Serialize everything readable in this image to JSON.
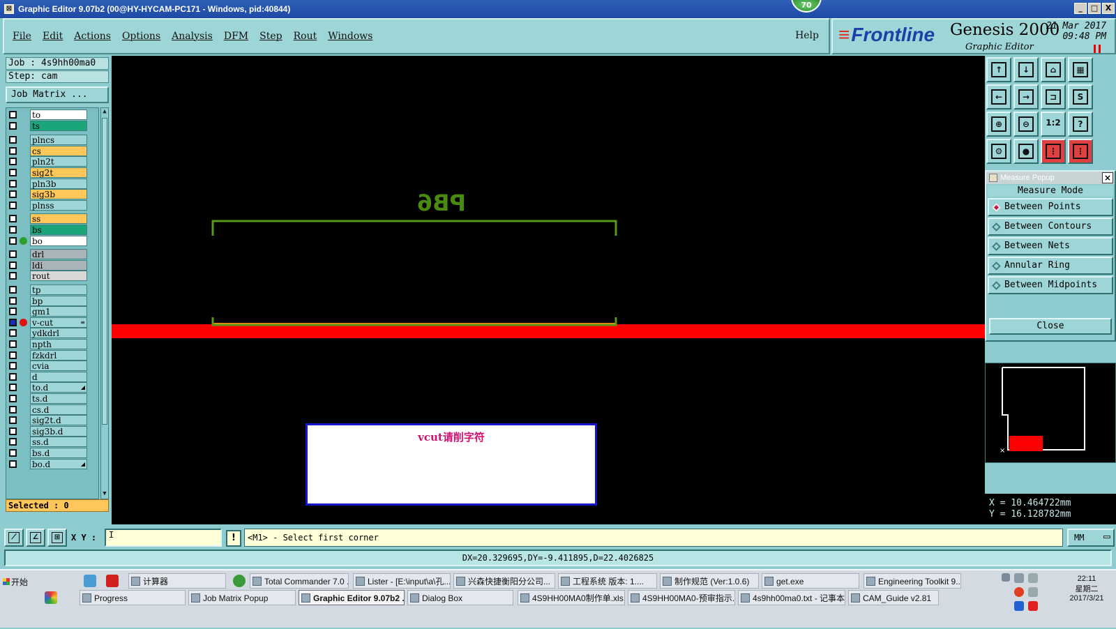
{
  "window": {
    "title": "Graphic Editor 9.07b2 (00@HY-HYCAM-PC171 - Windows, pid:40844)",
    "badge": "70",
    "min": "_",
    "max": "□",
    "close": "X"
  },
  "menu": {
    "items": [
      "File",
      "Edit",
      "Actions",
      "Options",
      "Analysis",
      "DFM",
      "Step",
      "Rout",
      "Windows"
    ],
    "help": "Help"
  },
  "brand": {
    "logo": "Frontline",
    "product": "Genesis 2000",
    "subtitle": "Graphic Editor",
    "date": "21 Mar 2017",
    "time": "09:48 PM"
  },
  "left": {
    "job": "Job : 4s9hh00ma0",
    "step": "Step: cam",
    "job_matrix": "Job Matrix ...",
    "selected": "Selected : 0",
    "layers": [
      {
        "name": "to",
        "color": "#ffffff",
        "group": 0
      },
      {
        "name": "ts",
        "color": "#1aa67a",
        "group": 0
      },
      {
        "name": "plncs",
        "color": "#9ed6d8",
        "group": 1
      },
      {
        "name": "cs",
        "color": "#ffc65a",
        "group": 1
      },
      {
        "name": "pln2t",
        "color": "#9ed6d8",
        "group": 1
      },
      {
        "name": "sig2t",
        "color": "#ffc65a",
        "group": 1
      },
      {
        "name": "pln3b",
        "color": "#9ed6d8",
        "group": 1
      },
      {
        "name": "sig3b",
        "color": "#ffc65a",
        "group": 1
      },
      {
        "name": "plnss",
        "color": "#9ed6d8",
        "group": 1
      },
      {
        "name": "ss",
        "color": "#ffc65a",
        "group": 2
      },
      {
        "name": "bs",
        "color": "#1aa67a",
        "group": 2
      },
      {
        "name": "bo",
        "color": "#ffffff",
        "group": 2,
        "dot": "#2aa02a"
      },
      {
        "name": "drl",
        "color": "#a8b4b8",
        "group": 3
      },
      {
        "name": "ldi",
        "color": "#a8b4b8",
        "group": 3
      },
      {
        "name": "rout",
        "color": "#d8d8d8",
        "group": 3
      },
      {
        "name": "tp",
        "color": "#9ed6d8",
        "group": 4
      },
      {
        "name": "bp",
        "color": "#9ed6d8",
        "group": 4
      },
      {
        "name": "gm1",
        "color": "#9ed6d8",
        "group": 4
      },
      {
        "name": "v-cut",
        "color": "#9ed6d8",
        "group": 4,
        "dot": "#e01010",
        "checked": true,
        "mark": "≡"
      },
      {
        "name": "ydkdrl",
        "color": "#9ed6d8",
        "group": 4
      },
      {
        "name": "npth",
        "color": "#9ed6d8",
        "group": 4
      },
      {
        "name": "fzkdrl",
        "color": "#9ed6d8",
        "group": 4
      },
      {
        "name": "cvia",
        "color": "#9ed6d8",
        "group": 4
      },
      {
        "name": "d",
        "color": "#9ed6d8",
        "group": 4
      },
      {
        "name": "to.d",
        "color": "#9ed6d8",
        "group": 4,
        "mark": "◢"
      },
      {
        "name": "ts.d",
        "color": "#9ed6d8",
        "group": 4
      },
      {
        "name": "cs.d",
        "color": "#9ed6d8",
        "group": 4
      },
      {
        "name": "sig2t.d",
        "color": "#9ed6d8",
        "group": 4
      },
      {
        "name": "sig3b.d",
        "color": "#9ed6d8",
        "group": 4
      },
      {
        "name": "ss.d",
        "color": "#9ed6d8",
        "group": 4
      },
      {
        "name": "bs.d",
        "color": "#9ed6d8",
        "group": 4
      },
      {
        "name": "bo.d",
        "color": "#9ed6d8",
        "group": 4,
        "mark": "◢"
      }
    ]
  },
  "canvas": {
    "mirrored_text": "PB6",
    "note": "vcut请削字符",
    "colors": {
      "outline": "#5a9a1a",
      "vcut": "#ff0000",
      "text": "#4a8a10",
      "orange": "#ff8a10"
    }
  },
  "measure": {
    "title": "Measure Popup",
    "mode_label": "Measure Mode",
    "options": [
      "Between Points",
      "Between Contours",
      "Between Nets",
      "Annular Ring",
      "Between Midpoints"
    ],
    "selected_index": 0,
    "close": "Close"
  },
  "coords": {
    "x": "X = 10.464722mm",
    "y": "Y = 16.128782mm"
  },
  "statusbar": {
    "xy_label": "X Y :",
    "xy_value": "I",
    "warn": "!",
    "prompt": "<M1> - Select first corner",
    "units": "MM",
    "measure_result": "DX=20.329695,DY=-9.411895,D=22.4026825"
  },
  "taskbar": {
    "start": "开始",
    "row1": [
      "计算器",
      "Total Commander 7.0 ...",
      "Lister - [E:\\input\\a\\孔...",
      "兴森快捷衡阳分公司...",
      "工程系统  版本: 1....",
      "制作规范 (Ver:1.0.6)",
      "get.exe",
      "Engineering Toolkit 9...."
    ],
    "row2": [
      "Progress",
      "Job Matrix Popup",
      "Graphic Editor 9.07b2 ...",
      "Dialog Box",
      "4S9HH00MA0制作单.xls...",
      "4S9HH00MA0-预审指示...",
      "4s9hh00ma0.txt - 记事本",
      "CAM_Guide v2.81"
    ],
    "active": "Graphic Editor 9.07b2 ...",
    "clock_time": "22:11",
    "clock_day": "星期二",
    "clock_date": "2017/3/21"
  }
}
